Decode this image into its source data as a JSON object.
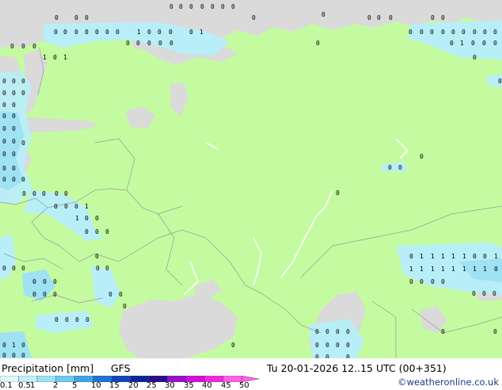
{
  "footer": {
    "title": "Precipitation [mm]",
    "model": "GFS",
    "valid_time": "Tu 20-01-2026 12..15 UTC (00+351)",
    "credit": "©weatheronline.co.uk"
  },
  "legend": {
    "labels": [
      "0.1",
      "0.5",
      "1",
      "2",
      "5",
      "10",
      "15",
      "20",
      "25",
      "30",
      "35",
      "40",
      "45",
      "50"
    ],
    "colors": [
      "#dcfbfb",
      "#bff1fb",
      "#99e3f7",
      "#6dcbef",
      "#3ea4e8",
      "#1e73d6",
      "#1246b8",
      "#0b2596",
      "#2a0a8a",
      "#9610c9",
      "#d20fd6",
      "#f227dc",
      "#ff60e6"
    ]
  },
  "palette": {
    "land": "#c4fba0",
    "sea": "#dadada",
    "light_precip": "#b8eef8",
    "precip": "#9ee2f4"
  },
  "precip_values": [
    "0",
    "0",
    "0",
    "0",
    "0",
    "0",
    "0",
    "0",
    "0",
    "0",
    "0",
    "0",
    "0",
    "0",
    "0",
    "0",
    "0",
    "0",
    "0",
    "1",
    "0",
    "0",
    "0",
    "0",
    "1",
    "0",
    "0",
    "0",
    "0",
    "0",
    "0",
    "0",
    "0",
    "0",
    "0",
    "0",
    "0",
    "0",
    "0",
    "0",
    "0",
    "0",
    "0",
    "0",
    "0",
    "0",
    "0",
    "0",
    "1",
    "0",
    "1",
    "0",
    "1",
    "0",
    "0",
    "0",
    "0",
    "0",
    "0",
    "0",
    "0",
    "0",
    "0",
    "0",
    "0",
    "0",
    "0",
    "0",
    "0",
    "0",
    "0",
    "0",
    "0",
    "0",
    "0",
    "0",
    "0",
    "0",
    "0",
    "0",
    "0",
    "0",
    "0",
    "0",
    "0",
    "0",
    "0",
    "0",
    "0",
    "0",
    "0",
    "0",
    "1",
    "1",
    "0",
    "0",
    "0",
    "0",
    "0",
    "0",
    "0",
    "0",
    "0",
    "0",
    "0",
    "0",
    "1",
    "1",
    "1",
    "1",
    "1",
    "0",
    "0",
    "1",
    "1",
    "1",
    "1",
    "1",
    "1",
    "1",
    "1",
    "1",
    "0",
    "0",
    "0",
    "0",
    "0",
    "0",
    "0",
    "0",
    "0",
    "0",
    "0",
    "0",
    "0",
    "0",
    "0",
    "0",
    "0",
    "0",
    "0",
    "0",
    "0",
    "0",
    "0",
    "0",
    "0",
    "0",
    "1",
    "0",
    "0",
    "0",
    "0",
    "0",
    "0",
    "0",
    "0",
    "0",
    "0",
    "0",
    "0",
    "0",
    "0",
    "0"
  ]
}
